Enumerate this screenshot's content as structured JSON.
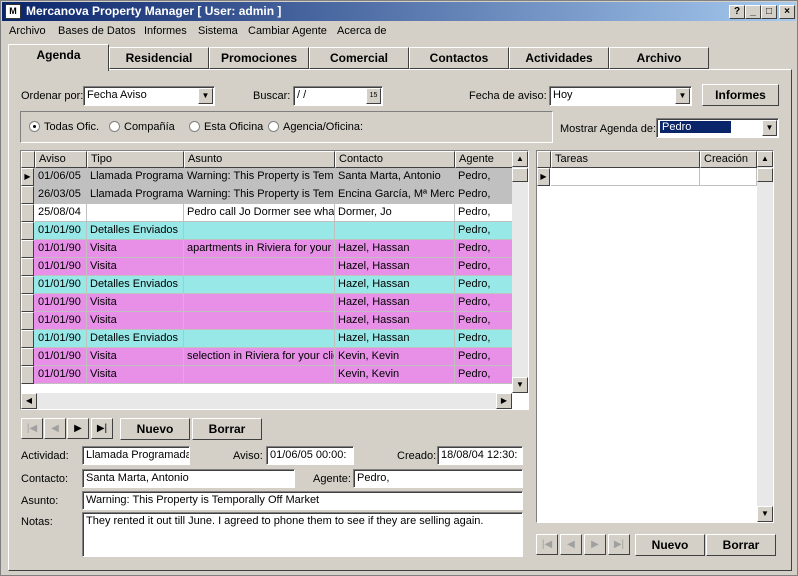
{
  "window": {
    "title": "Mercanova Property Manager [ User: admin ]",
    "logo": "M"
  },
  "title_buttons": {
    "help": "?",
    "minimize": "_",
    "maximize": "□",
    "close": "×"
  },
  "menu": [
    "Archivo",
    "Bases de Datos",
    "Informes",
    "Sistema",
    "Cambiar Agente",
    "Acerca de"
  ],
  "tabs": [
    "Agenda",
    "Residencial",
    "Promociones",
    "Comercial",
    "Contactos",
    "Actividades",
    "Archivo"
  ],
  "filters": {
    "ordenar_label": "Ordenar por:",
    "ordenar_value": "Fecha Aviso",
    "buscar_label": "Buscar:",
    "buscar_value": " / /",
    "fecha_aviso_label": "Fecha de aviso:",
    "fecha_aviso_value": "Hoy",
    "informes_button": "Informes",
    "mostrar_label": "Mostrar Agenda de:",
    "mostrar_value": "Pedro"
  },
  "radios": [
    "Todas Ofic.",
    "Compañía",
    "Esta Oficina",
    "Agencia/Oficina:"
  ],
  "agenda_headers": [
    "Aviso",
    "Tipo",
    "Asunto",
    "Contacto",
    "Agente"
  ],
  "agenda_rows": [
    {
      "aviso": "01/06/05",
      "tipo": "Llamada Programada",
      "asunto": "Warning: This Property is Temporally Off Market",
      "contacto": "Santa Marta, Antonio",
      "agente": "Pedro,"
    },
    {
      "aviso": "26/03/05",
      "tipo": "Llamada Programada",
      "asunto": "Warning: This Property is Temporally Off Market",
      "contacto": "Encina García, Mª Mercedes",
      "agente": "Pedro,"
    },
    {
      "aviso": "25/08/04",
      "tipo": "",
      "asunto": "Pedro call Jo Dormer see whats happening",
      "contacto": "Dormer, Jo",
      "agente": "Pedro,"
    },
    {
      "aviso": "01/01/90",
      "tipo": "Detalles Enviados",
      "asunto": "",
      "contacto": "",
      "agente": "Pedro,"
    },
    {
      "aviso": "01/01/90",
      "tipo": "Visita",
      "asunto": "apartments in Riviera for your client",
      "contacto": "Hazel, Hassan",
      "agente": "Pedro,"
    },
    {
      "aviso": "01/01/90",
      "tipo": "Visita",
      "asunto": "",
      "contacto": "Hazel, Hassan",
      "agente": "Pedro,"
    },
    {
      "aviso": "01/01/90",
      "tipo": "Detalles Enviados",
      "asunto": "",
      "contacto": "Hazel, Hassan",
      "agente": "Pedro,"
    },
    {
      "aviso": "01/01/90",
      "tipo": "Visita",
      "asunto": "",
      "contacto": "Hazel, Hassan",
      "agente": "Pedro,"
    },
    {
      "aviso": "01/01/90",
      "tipo": "Visita",
      "asunto": "",
      "contacto": "Hazel, Hassan",
      "agente": "Pedro,"
    },
    {
      "aviso": "01/01/90",
      "tipo": "Detalles Enviados",
      "asunto": "",
      "contacto": "Hazel, Hassan",
      "agente": "Pedro,"
    },
    {
      "aviso": "01/01/90",
      "tipo": "Visita",
      "asunto": "selection in Riviera for your client",
      "contacto": "Kevin, Kevin",
      "agente": "Pedro,"
    },
    {
      "aviso": "01/01/90",
      "tipo": "Visita",
      "asunto": "",
      "contacto": "Kevin, Kevin",
      "agente": "Pedro,"
    }
  ],
  "row_colors": {
    "gray": "#c0c0c0",
    "white": "#ffffff",
    "cyan": "#98e8e8",
    "pink": "#e890e8"
  },
  "row_color_keys": [
    "gray",
    "gray",
    "white",
    "cyan",
    "pink",
    "pink",
    "cyan",
    "pink",
    "pink",
    "cyan",
    "pink",
    "pink"
  ],
  "tasks_headers": [
    "Tareas",
    "Creación"
  ],
  "buttons": {
    "nuevo": "Nuevo",
    "borrar": "Borrar"
  },
  "nav_icons": {
    "first": "|◀",
    "prev": "◀",
    "next": "▶",
    "last": "▶|"
  },
  "detail": {
    "actividad_label": "Actividad:",
    "actividad_value": "Llamada Programada",
    "aviso_label": "Aviso:",
    "aviso_value": "01/06/05 00:00:",
    "creado_label": "Creado:",
    "creado_value": "18/08/04 12:30:",
    "contacto_label": "Contacto:",
    "contacto_value": "Santa Marta, Antonio",
    "agente_label": "Agente:",
    "agente_value": "Pedro,",
    "asunto_label": "Asunto:",
    "asunto_value": "Warning: This Property is Temporally Off Market",
    "notas_label": "Notas:",
    "notas_value": "They rented it out till June. I agreed to phone them to see if they are selling again."
  }
}
